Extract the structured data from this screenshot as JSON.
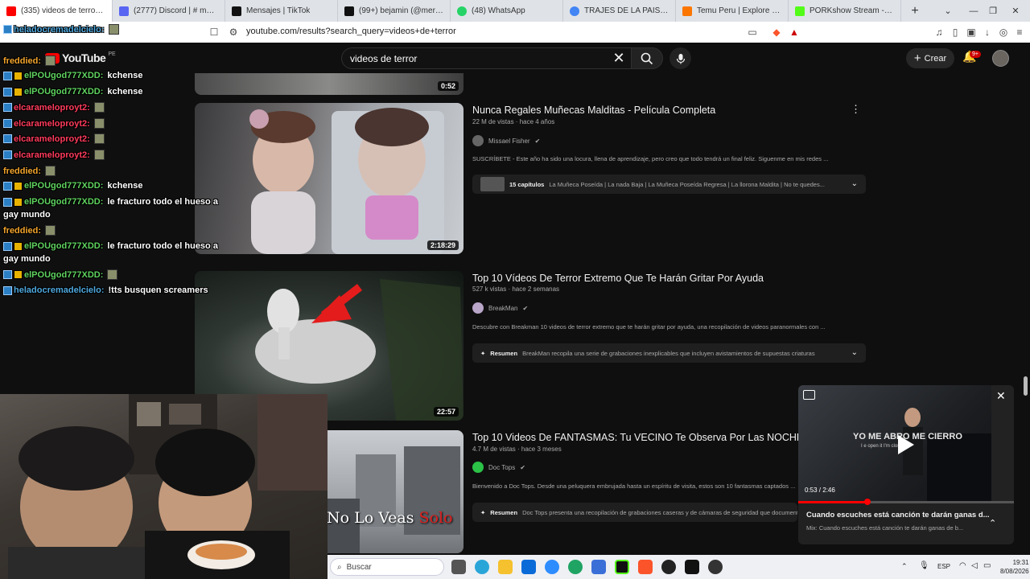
{
  "browser": {
    "tabs": [
      {
        "label": "(335) videos de terror - YouTube",
        "color": "#ff0000",
        "active": true
      },
      {
        "label": "(2777) Discord | # multimedia",
        "color": "#5865f2"
      },
      {
        "label": "Mensajes | TikTok",
        "color": "#111111"
      },
      {
        "label": "(99+) bejamin (@merch88_) | TikTok",
        "color": "#111111"
      },
      {
        "label": "(48) WhatsApp",
        "color": "#25d366"
      },
      {
        "label": "TRAJES DE LA PAISANA JACINTA",
        "color": "#4285f4"
      },
      {
        "label": "Temu Peru | Explore the Latest",
        "color": "#fb7701"
      },
      {
        "label": "PORKshow Stream - Watch Live",
        "color": "#53fc18"
      }
    ],
    "new_tab": "+",
    "url": "youtube.com/results?search_query=videos+de+terror"
  },
  "youtube": {
    "logo": "YouTube",
    "country": "PE",
    "search_value": "videos de terror",
    "create_label": "Crear",
    "notif_badge": "9+"
  },
  "results": [
    {
      "duration": "0:52"
    },
    {
      "title": "Nunca Regales Muñecas Malditas - Película Completa",
      "meta": "22 M de vistas · hace 4 años",
      "channel": "Missael Fisher",
      "desc": "SUSCRÍBETE - Este año ha sido una locura, llena de aprendizaje, pero creo que todo tendrá un final feliz. Siguenme en mis redes ...",
      "box_bold": "15 capítulos",
      "box_text": "La Muñeca Poseída | La nada Baja | La Muñeca Poseída Regresa | La llorona Maldita | No te quedes...",
      "duration": "2:18:29"
    },
    {
      "title": "Top 10 Vídeos De Terror Extremo Que Te Harán Gritar Por Ayuda",
      "meta": "527 k vistas · hace 2 semanas",
      "channel": "BreakMan",
      "desc": "Descubre con Breakman 10 videos de terror extremo que te harán gritar por ayuda, una recopilación de videos paranormales con ...",
      "box_bold": "Resumen",
      "box_text": "BreakMan recopila una serie de grabaciones inexplicables que incluyen avistamientos de supuestas criaturas",
      "duration": "22:57"
    },
    {
      "title": "Top 10 Videos De FANTASMAS: Tu VECINO Te Observa Por Las NOCHES...",
      "meta": "4.7 M de vistas · hace 3 meses",
      "channel": "Doc Tops",
      "desc": "Bienvenido a Doc Tops. Desde una peluquera embrujada hasta un espíritu de visita, estos son 10 fantasmas captados ...",
      "box_bold": "Resumen",
      "box_text": "Doc Tops presenta una recopilación de grabaciones caseras y de cámaras de seguridad que documentan",
      "thumb_text_1": "No Lo Veas",
      "thumb_text_2": "Solo"
    }
  ],
  "chat": [
    {
      "user": "heladocremadelcielo:",
      "color": "#4ea8de",
      "msg": ""
    },
    {
      "user": "freddied:",
      "color": "#f4a52c",
      "msg": ""
    },
    {
      "user": "elPOUgod777XDD:",
      "color": "#5fd35f",
      "msg": "kchense"
    },
    {
      "user": "elPOUgod777XDD:",
      "color": "#5fd35f",
      "msg": "kchense"
    },
    {
      "user": "elcarameloproyt2:",
      "color": "#ff3b5c",
      "msg": ""
    },
    {
      "user": "elcarameloproyt2:",
      "color": "#ff3b5c",
      "msg": ""
    },
    {
      "user": "elcarameloproyt2:",
      "color": "#ff3b5c",
      "msg": ""
    },
    {
      "user": "elcarameloproyt2:",
      "color": "#ff3b5c",
      "msg": ""
    },
    {
      "user": "freddied:",
      "color": "#f4a52c",
      "msg": ""
    },
    {
      "user": "elPOUgod777XDD:",
      "color": "#5fd35f",
      "msg": "kchense"
    },
    {
      "user": "elPOUgod777XDD:",
      "color": "#5fd35f",
      "msg": "le fracturo todo el hueso a",
      "wrap": "gay mundo"
    },
    {
      "user": "freddied:",
      "color": "#f4a52c",
      "msg": ""
    },
    {
      "user": "elPOUgod777XDD:",
      "color": "#5fd35f",
      "msg": "le fracturo todo el hueso a",
      "wrap": "gay mundo"
    },
    {
      "user": "elPOUgod777XDD:",
      "color": "#5fd35f",
      "msg": ""
    },
    {
      "user": "heladocremadelcielo:",
      "color": "#4ea8de",
      "msg": "!tts busquen screamers"
    }
  ],
  "miniplayer": {
    "overlay_text": "YO ME ABRO ME CIERRO",
    "overlay_sub": "I e open it I'm closing",
    "time": "0:53 / 2:46",
    "progress": 0.32,
    "title": "Cuando escuches está canción te darán ganas d...",
    "sub": "Mix: Cuando escuches está canción te darán ganas de b..."
  },
  "taskbar": {
    "search_placeholder": "Buscar",
    "lang": "ESP",
    "time": "19:31",
    "date": "8/08/2026"
  }
}
